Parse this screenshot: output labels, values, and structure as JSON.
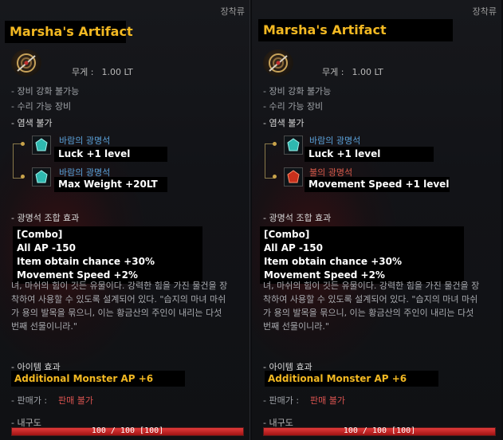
{
  "tooltips": [
    {
      "category": "장착류",
      "title": "Marsha's Artifact",
      "weight_label": "무게 :",
      "weight_value": "1.00 LT",
      "line1": "- 장비 강화 불가능",
      "line2": "- 수리 가능 장비",
      "line3": "- 염색 불가",
      "gems": [
        {
          "name": "바람의 광명석",
          "stat": "Luck +1 level",
          "color": "teal"
        },
        {
          "name": "바람의 광명석",
          "stat": "Max Weight +20LT",
          "color": "teal"
        }
      ],
      "combo_header": "- 광명석 조합 효과",
      "combo": [
        "[Combo]",
        "All AP -150",
        "Item obtain chance +30%",
        "Movement Speed +2%"
      ],
      "desc": [
        "녀, 마쉬의 힘이 깃든 유물이다. 강력한 힘을 가진 물건을 장",
        "착하여 사용할 수 있도록 설계되어 있다. \"습지의 마녀 마쉬",
        "가 용의 발목을 묶으니, 이는 황금산의 주인이 내리는 다섯",
        "번째 선물이니라.\""
      ],
      "item_effect_label": "- 아이템 효과",
      "item_effect": "Additional Monster AP +6",
      "sell_label": "- 판매가 :",
      "sell_value": "판매 불가",
      "durability_label": "- 내구도",
      "durability_text": "100 / 100 [100]",
      "durability_fraction": 1.0
    },
    {
      "category": "장착류",
      "title": "Marsha's Artifact",
      "weight_label": "무게 :",
      "weight_value": "1.00 LT",
      "line1": "- 장비 강화 불가능",
      "line2": "- 수리 가능 장비",
      "line3": "- 염색 불가",
      "gems": [
        {
          "name": "바람의 광명석",
          "stat": "Luck +1 level",
          "color": "teal"
        },
        {
          "name": "불의 광명석",
          "stat": "Movement Speed +1 level",
          "color": "red"
        }
      ],
      "combo_header": "- 광명석 조합 효과",
      "combo": [
        "[Combo]",
        "All AP -150",
        "Item obtain chance +30%",
        "Movement Speed +2%"
      ],
      "desc": [
        "녀, 마쉬의 힘이 깃든 유물이다. 강력한 힘을 가진 물건을 장",
        "착하여 사용할 수 있도록 설계되어 있다. \"습지의 마녀 마쉬",
        "가 용의 발목을 묶으니, 이는 황금산의 주인이 내리는 다섯",
        "번째 선물이니라.\""
      ],
      "item_effect_label": "- 아이템 효과",
      "item_effect": "Additional Monster AP +6",
      "sell_label": "- 판매가 :",
      "sell_value": "판매 불가",
      "durability_label": "- 내구도",
      "durability_text": "100 / 100 [100]",
      "durability_fraction": 1.0
    }
  ]
}
